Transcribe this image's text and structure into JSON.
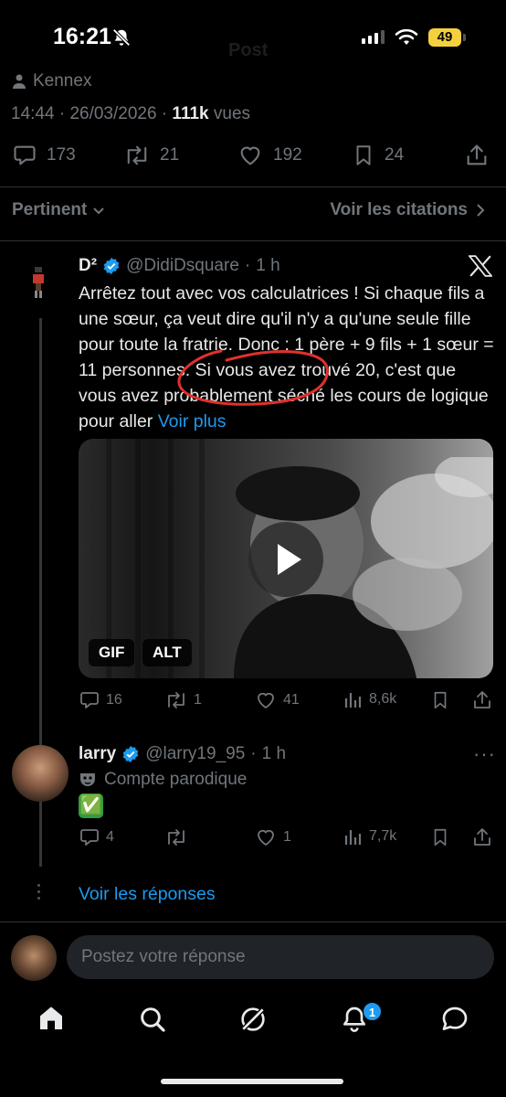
{
  "status_bar": {
    "time": "16:21",
    "battery": "49"
  },
  "header": {
    "title": "Post"
  },
  "post": {
    "author": "Kennex",
    "time": "14:44",
    "date": "26/03/2026",
    "views_count": "111k",
    "views_label": "vues",
    "stats": {
      "replies": "173",
      "reposts": "21",
      "likes": "192",
      "bookmarks": "24"
    }
  },
  "sort": {
    "label": "Pertinent",
    "citations": "Voir les citations"
  },
  "replies": [
    {
      "name": "D²",
      "handle": "@DidiDsquare",
      "age": "1 h",
      "text": "Arrêtez tout avec vos calculatrices ! Si chaque fils a une sœur, ça veut dire qu'il n'y a qu'une seule fille pour toute la fratrie. Donc : 1 père + 9 fils + 1 sœur = 11 personnes. Si vous avez trouvé 20, c'est que vous avez probablement séché les cours de logique pour aller",
      "more": "Voir plus",
      "media_badges": [
        "GIF",
        "ALT"
      ],
      "actions": {
        "replies": "16",
        "reposts": "1",
        "likes": "41",
        "views": "8,6k"
      }
    },
    {
      "name": "larry",
      "handle": "@larry19_95",
      "age": "1 h",
      "parody": "Compte parodique",
      "emoji": "✅",
      "actions": {
        "replies": "4",
        "reposts": "",
        "likes": "1",
        "views": "7,7k"
      }
    }
  ],
  "view_replies": "Voir les réponses",
  "composer": {
    "placeholder": "Postez votre réponse"
  },
  "tabbar": {
    "notifications_badge": "1"
  },
  "colors": {
    "accent": "#1d9bf0",
    "muted": "#71767b",
    "background": "#000000",
    "battery": "#f4d03f"
  }
}
